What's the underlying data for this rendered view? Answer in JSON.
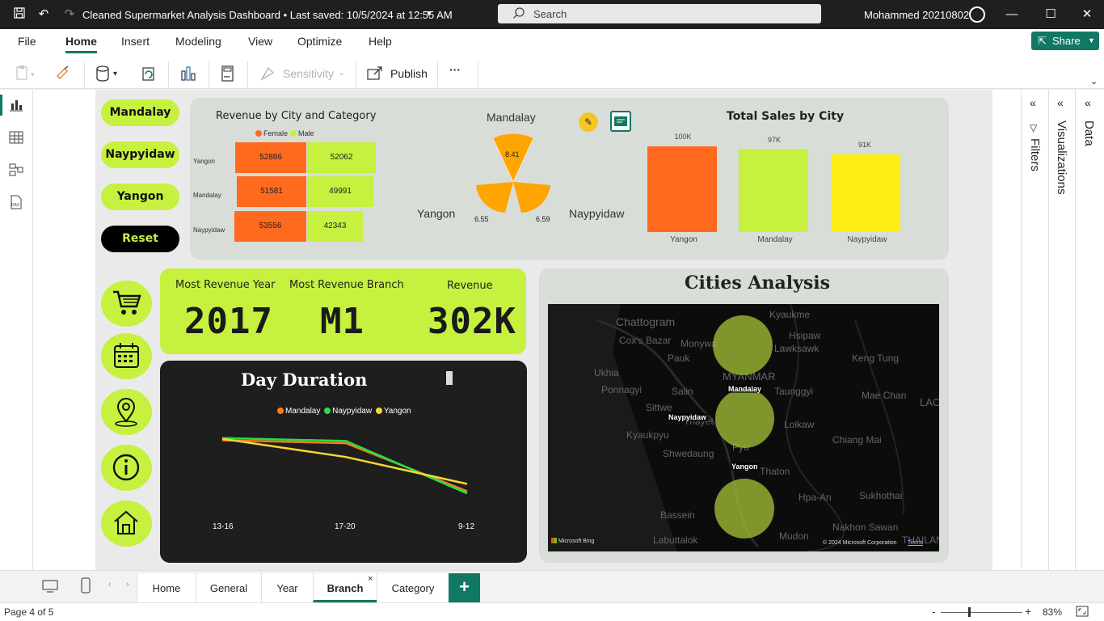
{
  "titlebar": {
    "title": "Cleaned Supermarket Analysis Dashboard • Last saved: 10/5/2024 at 12:55 AM",
    "search_placeholder": "Search",
    "user": "Mohammed 20210802"
  },
  "ribbon": {
    "menus": [
      "File",
      "Home",
      "Insert",
      "Modeling",
      "View",
      "Optimize",
      "Help"
    ],
    "active_menu": "Home",
    "share": "Share",
    "sensitivity": "Sensitivity",
    "publish": "Publish",
    "more": "···"
  },
  "colors": {
    "accent": "#117865",
    "lime": "#c6f13e",
    "orange": "#ff6a1f",
    "panel": "#d8ddd8",
    "dark_panel": "#1e1e1e",
    "yellow": "#ffee14"
  },
  "slicer_buttons": [
    "Mandalay",
    "Naypyidaw",
    "Yangon",
    "Reset"
  ],
  "nav_icons": [
    "cart-icon",
    "calendar-icon",
    "location-pin-icon",
    "info-icon",
    "home-icon"
  ],
  "revenue_matrix": {
    "title": "Revenue by City and Category",
    "legend": [
      "Female",
      "Male"
    ],
    "rows": [
      {
        "city": "Yangon",
        "female": "52886",
        "male": "52062"
      },
      {
        "city": "Mandalay",
        "female": "51581",
        "male": "49991"
      },
      {
        "city": "Naypyidaw",
        "female": "53556",
        "male": "42343"
      }
    ]
  },
  "radar": {
    "top_label": "Mandalay",
    "left_label": "Yangon",
    "right_label": "Naypyidaw",
    "values": {
      "top": "8.41",
      "left": "6.55",
      "right": "6.59"
    }
  },
  "total_sales": {
    "title": "Total Sales by City",
    "bars": [
      {
        "city": "Yangon",
        "label": "100K",
        "value": 100,
        "color": "#ff6a1f"
      },
      {
        "city": "Mandalay",
        "label": "97K",
        "value": 97,
        "color": "#c6f13e"
      },
      {
        "city": "Naypyidaw",
        "label": "91K",
        "value": 91,
        "color": "#ffee14"
      }
    ]
  },
  "kpis": {
    "year_label": "Most Revenue Year",
    "year_value": "2017",
    "branch_label": "Most Revenue Branch",
    "branch_value": "M1",
    "revenue_label": "Revenue",
    "revenue_value": "302K"
  },
  "day_duration": {
    "title": "Day Duration",
    "legend": [
      "Mandalay",
      "Naypyidaw",
      "Yangon"
    ],
    "categories": [
      "13-16",
      "17-20",
      "9-12"
    ]
  },
  "chart_data": {
    "type": "line",
    "categories": [
      "13-16",
      "17-20",
      "9-12"
    ],
    "series": [
      {
        "name": "Mandalay",
        "values": [
          0.95,
          0.91,
          0.25
        ]
      },
      {
        "name": "Naypyidaw",
        "values": [
          0.98,
          0.94,
          0.22
        ]
      },
      {
        "name": "Yangon",
        "values": [
          0.97,
          0.72,
          0.35
        ]
      }
    ]
  },
  "map": {
    "title": "Cities Analysis",
    "bubbles": [
      "Mandalay",
      "Naypyidaw",
      "Yangon"
    ],
    "base_labels": [
      "Chattogram",
      "Kyaukme",
      "Hsipaw",
      "Lawksawk",
      "Keng Tung",
      "Mae Chan",
      "Chiang Mai",
      "Loikaw",
      "Taunggyi",
      "Sukhothai",
      "Hpa-An",
      "Nakhon Sawan",
      "Bassein",
      "Labuttalok",
      "Kyaukpyu",
      "Sittwe",
      "Pauk",
      "Monywa",
      "Salin",
      "Thayet",
      "Shwedaung",
      "Pyu",
      "Thaton",
      "Mudon",
      "Ukhia",
      "Ponnagyi",
      "Cox's Bazar",
      "MYANMAR",
      "LAOS",
      "THAILAN"
    ],
    "bing": "Microsoft Bing",
    "copyright": "© 2024 Microsoft Corporation",
    "terms": "Terms"
  },
  "tabs": [
    "Home",
    "General",
    "Year",
    "Branch",
    "Category"
  ],
  "active_tab": "Branch",
  "status": {
    "page": "Page 4 of 5",
    "zoom": "83%"
  },
  "panes": {
    "filters": "Filters",
    "visualizations": "Visualizations",
    "data": "Data"
  }
}
